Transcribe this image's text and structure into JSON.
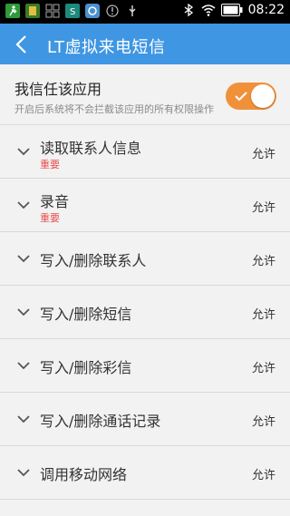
{
  "status_bar": {
    "time": "08:22",
    "icons": [
      "runner-icon",
      "app-icon",
      "grid-icon",
      "s-icon",
      "update-icon",
      "info-icon",
      "usb-icon",
      "bluetooth-icon",
      "wifi-icon",
      "battery-icon"
    ]
  },
  "app_bar": {
    "title": "LT虚拟来电短信"
  },
  "trust": {
    "title": "我信任该应用",
    "subtitle": "开启后系统将不会拦截该应用的所有权限操作",
    "toggle_on": true
  },
  "colors": {
    "app_bar": "#3f96e3",
    "toggle": "#f0913a",
    "important": "#e85050"
  },
  "permissions": [
    {
      "label": "读取联系人信息",
      "tag": "重要",
      "action": "允许"
    },
    {
      "label": "录音",
      "tag": "重要",
      "action": "允许"
    },
    {
      "label": "写入/删除联系人",
      "tag": "",
      "action": "允许"
    },
    {
      "label": "写入/删除短信",
      "tag": "",
      "action": "允许"
    },
    {
      "label": "写入/删除彩信",
      "tag": "",
      "action": "允许"
    },
    {
      "label": "写入/删除通话记录",
      "tag": "",
      "action": "允许"
    },
    {
      "label": "调用移动网络",
      "tag": "",
      "action": "允许"
    }
  ]
}
